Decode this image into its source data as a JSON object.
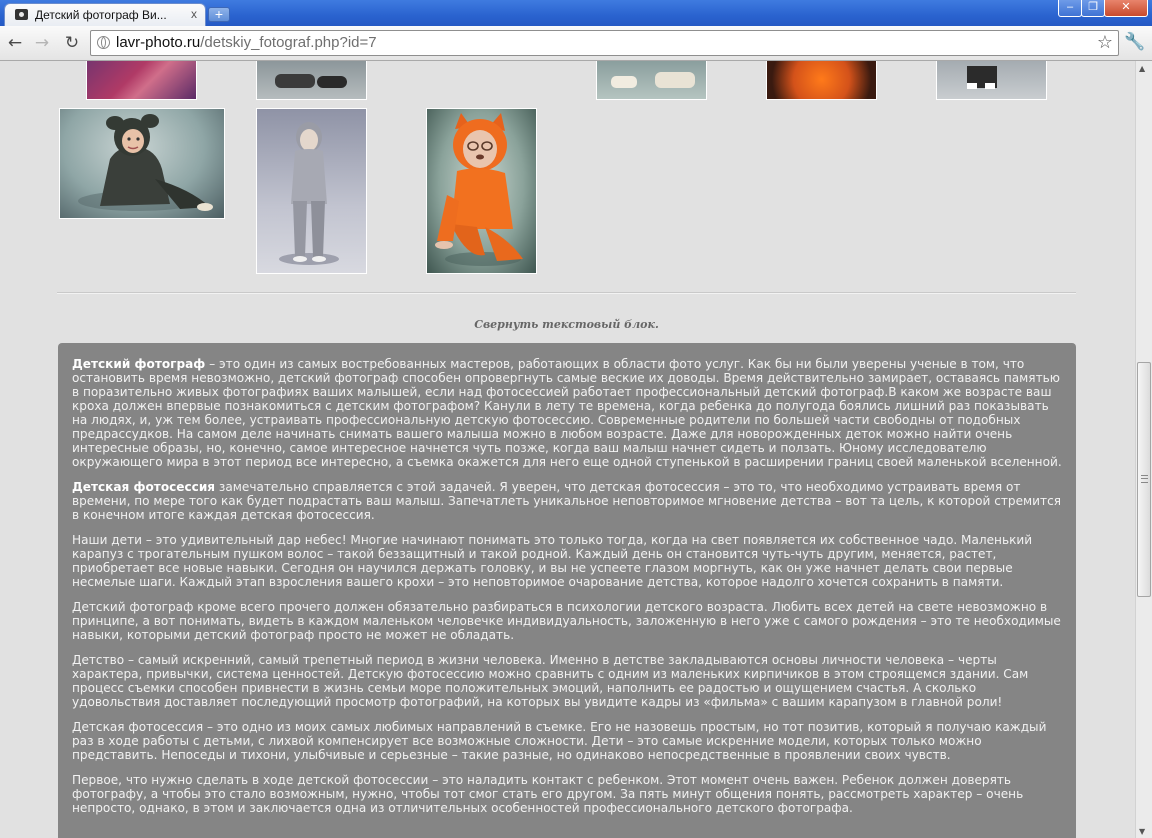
{
  "browser": {
    "tab_title": "Детский фотограф Ви...",
    "tab_close": "x",
    "new_tab": "+",
    "window_controls": {
      "minimize": "–",
      "maximize": "❐",
      "close": "✕"
    },
    "url_domain": "lavr-photo.ru",
    "url_path": "/detskiy_fotograf.php?id=7",
    "icons": [
      "camera-favicon",
      "back-icon",
      "forward-icon",
      "reload-icon",
      "globe-icon",
      "star-icon",
      "wrench-icon"
    ]
  },
  "page": {
    "collapse_link": "Свернуть текстовый блок.",
    "photos_top_row_count": 5,
    "photos_second_row": [
      "child-in-dark-bear-costume",
      "girl-in-grey-hoodie",
      "child-in-orange-fox-costume"
    ]
  },
  "article": {
    "p1_bold": "Детский фотограф",
    "p1": " – это один из самых востребованных мастеров, работающих в области фото услуг. Как бы ни были уверены ученые в том, что остановить время невозможно, детский фотограф способен опровергнуть самые веские их доводы. Время действительно замирает, оставаясь памятью в поразительно живых фотографиях ваших малышей, если над фотосессией работает профессиональный детский фотограф.В каком же возрасте ваш кроха должен впервые познакомиться с детским фотографом? Канули в лету те времена, когда ребенка до полугода боялись лишний раз показывать на людях, и, уж тем более, устраивать профессиональную детскую фотосессию. Современные родители по большей части свободны от подобных предрассудков. На самом деле начинать снимать вашего малыша можно в любом возрасте. Даже для новорожденных деток можно найти очень интересные образы, но, конечно, самое интересное начнется чуть позже, когда ваш малыш начнет сидеть и ползать. Юному исследователю окружающего мира в этот период все интересно, а съемка окажется для него еще одной ступенькой в расширении границ своей маленькой вселенной.",
    "p2_bold": "Детская фотосессия",
    "p2": " замечательно справляется с этой задачей. Я уверен, что детская фотосессия – это то, что необходимо устраивать время от времени, по мере того как будет подрастать ваш малыш. Запечатлеть уникальное неповторимое мгновение детства – вот та цель, к которой стремится в конечном итоге каждая детская фотосессия.",
    "p3": "Наши дети – это удивительный дар небес! Многие начинают понимать это только тогда, когда на свет появляется их собственное чадо. Маленький карапуз с трогательным пушком волос – такой беззащитный и такой родной. Каждый день он становится чуть-чуть другим, меняется, растет, приобретает все новые навыки. Сегодня он научился держать головку, и вы не успеете глазом моргнуть, как он уже начнет делать свои первые несмелые шаги. Каждый этап взросления вашего крохи – это неповторимое очарование детства, которое надолго хочется сохранить в памяти.",
    "p4": "Детский фотограф кроме всего прочего должен обязательно разбираться в психологии детского возраста.  Любить всех детей на свете невозможно в принципе, а вот понимать, видеть в каждом маленьком человечке индивидуальность, заложенную в него уже с самого рождения – это те необходимые навыки, которыми детский фотограф просто не может не обладать.",
    "p5": "Детство – самый искренний, самый трепетный период в жизни человека. Именно в детстве закладываются основы личности человека – черты характера, привычки, система ценностей. Детскую фотосессию  можно сравнить с одним из маленьких кирпичиков в этом строящемся здании. Сам процесс съемки способен привнести в жизнь семьи море положительных эмоций, наполнить ее радостью и ощущением счастья. А сколько удовольствия доставляет последующий просмотр фотографий, на которых вы увидите кадры из «фильма» с вашим карапузом в главной роли!",
    "p6": "Детская фотосессия – это одно из моих самых любимых направлений в съемке. Его не назовешь простым, но тот позитив, который я получаю каждый раз в ходе работы с детьми, с лихвой компенсирует все возможные сложности. Дети – это самые искренние модели, которых только можно представить. Непоседы и тихони, улыбчивые и серьезные – такие разные, но одинаково непосредственные в проявлении своих чувств.",
    "p7": "Первое, что нужно сделать в ходе детской фотосессии – это наладить контакт с ребенком. Этот момент очень важен. Ребенок должен доверять фотографу, а чтобы это стало возможным, нужно, чтобы тот смог стать его другом. За пять минут общения понять, рассмотреть характер – очень непросто, однако, в этом и заключается одна из отличительных особенностей профессионального детского фотографа."
  },
  "colors": {
    "text_block_bg": "#858585",
    "page_bg": "#e1e1e1",
    "accent_orange": "#e06a1e"
  }
}
